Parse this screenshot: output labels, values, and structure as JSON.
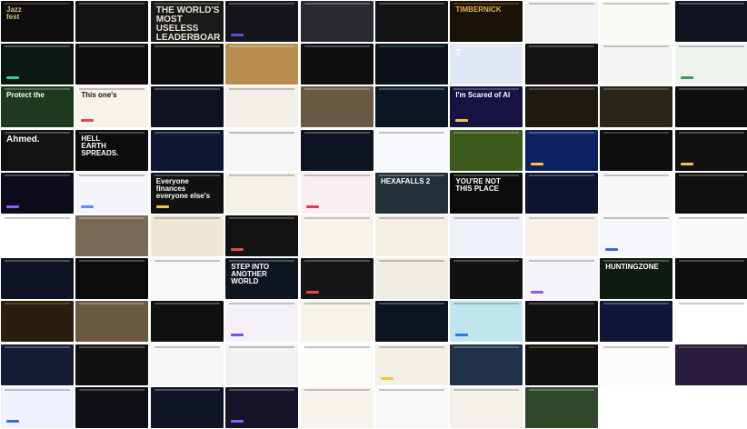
{
  "grid": {
    "columns": 10,
    "rows": 10,
    "tiles": [
      {
        "headline": "Jazz\nfest",
        "bg": "#0e0e0e",
        "fg": "#d9c27a",
        "accent": ""
      },
      {
        "headline": "",
        "bg": "#121212",
        "fg": "#ffffff",
        "accent": ""
      },
      {
        "headline": "THE WORLD'S\nMOST USELESS\nLEADERBOARD",
        "bg": "#1a1a1a",
        "fg": "#e8e2d2",
        "accent": "",
        "large": true
      },
      {
        "headline": "",
        "bg": "#15161c",
        "fg": "#ffffff",
        "accent": "#5b4bdf"
      },
      {
        "headline": "",
        "bg": "#2a2b31",
        "fg": "#ffffff",
        "accent": ""
      },
      {
        "headline": "",
        "bg": "#101214",
        "fg": "#ffffff",
        "accent": ""
      },
      {
        "headline": "TIMBERNICK",
        "bg": "#1a1208",
        "fg": "#e6b24a",
        "accent": ""
      },
      {
        "headline": "",
        "bg": "#f3f3f3",
        "fg": "#222222",
        "accent": ""
      },
      {
        "headline": "",
        "bg": "#fbfbf5",
        "fg": "#222222",
        "accent": ""
      },
      {
        "headline": "",
        "bg": "#0f1420",
        "fg": "#ffffff",
        "accent": ""
      },
      {
        "headline": "",
        "bg": "#0c1613",
        "fg": "#ffffff",
        "accent": "#2fd18a"
      },
      {
        "headline": "",
        "bg": "#0d0d0d",
        "fg": "#ffffff",
        "accent": ""
      },
      {
        "headline": "",
        "bg": "#0f0f0f",
        "fg": "#ffffff",
        "accent": ""
      },
      {
        "headline": "",
        "bg": "#b98d4e",
        "fg": "#ffffff",
        "accent": ""
      },
      {
        "headline": "",
        "bg": "#0e0e0e",
        "fg": "#ffffff",
        "accent": ""
      },
      {
        "headline": "",
        "bg": "#0c1218",
        "fg": "#45d6e6",
        "accent": ""
      },
      {
        "headline": "T",
        "bg": "#e0e8f5",
        "fg": "#ffffff",
        "accent": "",
        "large": true
      },
      {
        "headline": "",
        "bg": "#131313",
        "fg": "#ffffff",
        "accent": ""
      },
      {
        "headline": "",
        "bg": "#f5f5f5",
        "fg": "#222222",
        "accent": ""
      },
      {
        "headline": "",
        "bg": "#eef3ee",
        "fg": "#222222",
        "accent": "#36a15a"
      },
      {
        "headline": "Protect the",
        "bg": "#1e3a1e",
        "fg": "#ffffff",
        "accent": ""
      },
      {
        "headline": "This one's",
        "bg": "#f7f2ea",
        "fg": "#111111",
        "accent": "#e64b3c"
      },
      {
        "headline": "",
        "bg": "#0f1320",
        "fg": "#ffffff",
        "accent": ""
      },
      {
        "headline": "",
        "bg": "#f3f0e9",
        "fg": "#222222",
        "accent": ""
      },
      {
        "headline": "",
        "bg": "#6a5a44",
        "fg": "#ffffff",
        "accent": ""
      },
      {
        "headline": "",
        "bg": "#0c1625",
        "fg": "#ffffff",
        "accent": ""
      },
      {
        "headline": "I'm Scared of AI",
        "bg": "#161242",
        "fg": "#ffffff",
        "accent": "#f0c542"
      },
      {
        "headline": "",
        "bg": "#1d1a12",
        "fg": "#c9b88c",
        "accent": ""
      },
      {
        "headline": "",
        "bg": "#2a2519",
        "fg": "#d8c89f",
        "accent": ""
      },
      {
        "headline": "",
        "bg": "#0f0f0f",
        "fg": "#ffffff",
        "accent": ""
      },
      {
        "headline": "Ahmed.",
        "bg": "#121212",
        "fg": "#ffffff",
        "accent": "",
        "large": true
      },
      {
        "headline": "HELL\nEARTH\nSPREADS.",
        "bg": "#0c0c0c",
        "fg": "#ffffff",
        "accent": ""
      },
      {
        "headline": "",
        "bg": "#0e1633",
        "fg": "#ffffff",
        "accent": ""
      },
      {
        "headline": "",
        "bg": "#f6f6f6",
        "fg": "#111111",
        "accent": ""
      },
      {
        "headline": "",
        "bg": "#0f1422",
        "fg": "#ffffff",
        "accent": ""
      },
      {
        "headline": "",
        "bg": "#f7f9fc",
        "fg": "#222222",
        "accent": ""
      },
      {
        "headline": "",
        "bg": "#3d5a1e",
        "fg": "#ffffff",
        "accent": ""
      },
      {
        "headline": "",
        "bg": "#0e2163",
        "fg": "#ffffff",
        "accent": "#f0c542"
      },
      {
        "headline": "",
        "bg": "#0e0e0e",
        "fg": "#cfc6a8",
        "accent": ""
      },
      {
        "headline": "",
        "bg": "#111111",
        "fg": "#ffffff",
        "accent": "#f0c542"
      },
      {
        "headline": "",
        "bg": "#0d0c1c",
        "fg": "#ffffff",
        "accent": "#8a5cff"
      },
      {
        "headline": "",
        "bg": "#f3f5fa",
        "fg": "#111111",
        "accent": "#5b8cff"
      },
      {
        "headline": "Everyone finances\neveryone else's",
        "bg": "#111111",
        "fg": "#ffffff",
        "accent": "#f0c542"
      },
      {
        "headline": "",
        "bg": "#f5f0e8",
        "fg": "#222222",
        "accent": ""
      },
      {
        "headline": "",
        "bg": "#fbeef0",
        "fg": "#222222",
        "accent": "#e23b5a"
      },
      {
        "headline": "HEXAFALLS 2",
        "bg": "#23303a",
        "fg": "#ffffff",
        "accent": ""
      },
      {
        "headline": "YOU'RE NOT\nTHIS PLACE",
        "bg": "#0c0c0c",
        "fg": "#ffffff",
        "accent": ""
      },
      {
        "headline": "",
        "bg": "#0f1430",
        "fg": "#ffffff",
        "accent": ""
      },
      {
        "headline": "",
        "bg": "#f7f7f7",
        "fg": "#222222",
        "accent": ""
      },
      {
        "headline": "",
        "bg": "#101010",
        "fg": "#ffffff",
        "accent": ""
      },
      {
        "headline": "",
        "bg": "#ffffff",
        "fg": "#222222",
        "accent": ""
      },
      {
        "headline": "",
        "bg": "#7a6a55",
        "fg": "#ffffff",
        "accent": ""
      },
      {
        "headline": "",
        "bg": "#efe6d6",
        "fg": "#222222",
        "accent": ""
      },
      {
        "headline": "",
        "bg": "#121212",
        "fg": "#ffffff",
        "accent": "#e64b3c"
      },
      {
        "headline": "",
        "bg": "#f7f3ec",
        "fg": "#222222",
        "accent": ""
      },
      {
        "headline": "",
        "bg": "#f4efe3",
        "fg": "#222222",
        "accent": ""
      },
      {
        "headline": "",
        "bg": "#eef1f7",
        "fg": "#222222",
        "accent": ""
      },
      {
        "headline": "",
        "bg": "#f7f0e6",
        "fg": "#5a3a1a",
        "accent": ""
      },
      {
        "headline": "",
        "bg": "#f6f7fa",
        "fg": "#222222",
        "accent": "#3a6bd8"
      },
      {
        "headline": "",
        "bg": "#fafafa",
        "fg": "#222222",
        "accent": ""
      },
      {
        "headline": "",
        "bg": "#0e1326",
        "fg": "#ffffff",
        "accent": ""
      },
      {
        "headline": "",
        "bg": "#0b0b0b",
        "fg": "#ffffff",
        "accent": ""
      },
      {
        "headline": "",
        "bg": "#f8f8f8",
        "fg": "#222222",
        "accent": ""
      },
      {
        "headline": "STEP INTO\nANOTHER\nWORLD",
        "bg": "#0d1520",
        "fg": "#ffffff",
        "accent": ""
      },
      {
        "headline": "",
        "bg": "#161616",
        "fg": "#ffffff",
        "accent": "#e64b3c"
      },
      {
        "headline": "",
        "bg": "#f0eee2",
        "fg": "#222222",
        "accent": ""
      },
      {
        "headline": "",
        "bg": "#111111",
        "fg": "#ffffff",
        "accent": ""
      },
      {
        "headline": "",
        "bg": "#f4f4f8",
        "fg": "#222222",
        "accent": "#8a5cff"
      },
      {
        "headline": "HUNTINGZONE",
        "bg": "#0f1a10",
        "fg": "#ffffff",
        "accent": ""
      },
      {
        "headline": "",
        "bg": "#0f0f0f",
        "fg": "#ffffff",
        "accent": ""
      },
      {
        "headline": "",
        "bg": "#2a1e0e",
        "fg": "#f0c542",
        "accent": ""
      },
      {
        "headline": "",
        "bg": "#6a5a40",
        "fg": "#ffffff",
        "accent": ""
      },
      {
        "headline": "",
        "bg": "#101010",
        "fg": "#ffffff",
        "accent": ""
      },
      {
        "headline": "",
        "bg": "#f4f2f8",
        "fg": "#222222",
        "accent": "#7a4cff"
      },
      {
        "headline": "",
        "bg": "#f7f3ea",
        "fg": "#222222",
        "accent": ""
      },
      {
        "headline": "",
        "bg": "#0e1322",
        "fg": "#ffffff",
        "accent": ""
      },
      {
        "headline": "",
        "bg": "#bfe6ee",
        "fg": "#222222",
        "accent": "#2a7ae8"
      },
      {
        "headline": "",
        "bg": "#111111",
        "fg": "#ffffff",
        "accent": ""
      },
      {
        "headline": "",
        "bg": "#0f1638",
        "fg": "#ffffff",
        "accent": ""
      },
      {
        "headline": "",
        "bg": "#ffffff",
        "fg": "#222222",
        "accent": ""
      },
      {
        "headline": "",
        "bg": "#161a33",
        "fg": "#ffffff",
        "accent": ""
      },
      {
        "headline": "",
        "bg": "#111111",
        "fg": "#ffffff",
        "accent": ""
      },
      {
        "headline": "",
        "bg": "#f7f7f7",
        "fg": "#222222",
        "accent": ""
      },
      {
        "headline": "",
        "bg": "#f2f2f2",
        "fg": "#222222",
        "accent": ""
      },
      {
        "headline": "",
        "bg": "#fbfbf8",
        "fg": "#222222",
        "accent": ""
      },
      {
        "headline": "",
        "bg": "#f5f0e6",
        "fg": "#222222",
        "accent": "#f0c542"
      },
      {
        "headline": "",
        "bg": "#20324a",
        "fg": "#ffffff",
        "accent": ""
      },
      {
        "headline": "",
        "bg": "#111111",
        "fg": "#f0c542",
        "accent": ""
      },
      {
        "headline": "",
        "bg": "#fbfbfb",
        "fg": "#222222",
        "accent": ""
      },
      {
        "headline": "",
        "bg": "#2a1c3e",
        "fg": "#f0c542",
        "accent": ""
      },
      {
        "headline": "",
        "bg": "#eef2ff",
        "fg": "#222222",
        "accent": "#3a6bd8"
      },
      {
        "headline": "",
        "bg": "#0e1014",
        "fg": "#ffffff",
        "accent": ""
      },
      {
        "headline": "",
        "bg": "#0f1426",
        "fg": "#ffffff",
        "accent": ""
      },
      {
        "headline": "",
        "bg": "#17142a",
        "fg": "#ffffff",
        "accent": "#8a5cff"
      },
      {
        "headline": "",
        "bg": "#f7f4ee",
        "fg": "#222222",
        "accent": ""
      },
      {
        "headline": "",
        "bg": "#f8f8f8",
        "fg": "#222222",
        "accent": ""
      },
      {
        "headline": "",
        "bg": "#f4f1ea",
        "fg": "#222222",
        "accent": ""
      },
      {
        "headline": "",
        "bg": "#2f4a2a",
        "fg": "#ffffff",
        "accent": ""
      },
      {
        "headline": "",
        "bg": "#ffffff",
        "fg": "#222222",
        "accent": ""
      },
      {
        "headline": "",
        "bg": "#ffffff",
        "fg": "#222222",
        "accent": ""
      }
    ]
  }
}
